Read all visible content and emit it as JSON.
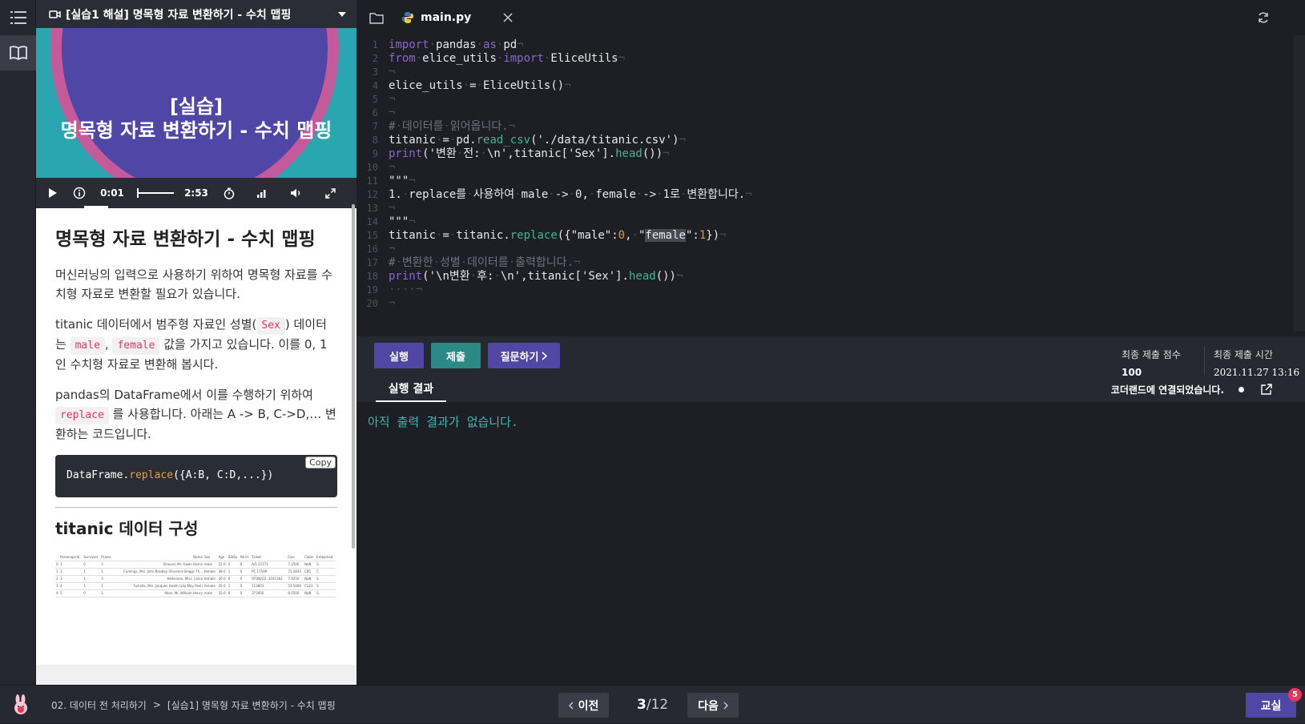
{
  "lesson": {
    "header_title": "[실습1 해설] 명목형 자료 변환하기 - 수치 맵핑",
    "video": {
      "title_line1": "[실습]",
      "title_line2": "명목형 자료 변환하기 - 수치 맵핑",
      "current_time": "0:01",
      "duration": "2:53",
      "progress_fraction": 0.006
    },
    "heading": "명목형 자료 변환하기 - 수치 맵핑",
    "p1": "머신러닝의 입력으로 사용하기 위하여 명목형 자료를 수치형 자료로 변환할 필요가 있습니다.",
    "p2_a": "titanic 데이터에서 범주형 자료인 성별(",
    "p2_sex": "Sex",
    "p2_b": ") 데이터는",
    "p2_male": "male",
    "p2_comma": ",",
    "p2_female": "female",
    "p2_c": "값을 가지고 있습니다. 이를 0, 1 인 수치형 자료로 변환해 봅시다.",
    "p3_a": "pandas의 DataFrame에서 이를 수행하기 위하여",
    "p3_replace": "replace",
    "p3_b": "를 사용합니다. 아래는 A -> B, C->D,… 변환하는 코드입니다.",
    "code_obj": "DataFrame.",
    "code_fn": "replace",
    "code_args": "({A:B, C:D,...})",
    "copy_label": "Copy",
    "subheading": "titanic 데이터 구성",
    "table": {
      "headers": [
        "",
        "PassengerId",
        "Survived",
        "Pclass",
        "Name",
        "Sex",
        "Age",
        "SibSp",
        "Parch",
        "Ticket",
        "Fare",
        "Cabin",
        "Embarked"
      ],
      "rows": [
        [
          "0",
          "1",
          "0",
          "3",
          "Braund, Mr. Owen Harris",
          "male",
          "22.0",
          "1",
          "0",
          "A/5 21171",
          "7.2500",
          "NaN",
          "S"
        ],
        [
          "1",
          "2",
          "1",
          "1",
          "Cumings, Mrs. John Bradley (Florence Briggs Th...",
          "female",
          "38.0",
          "1",
          "0",
          "PC 17599",
          "71.2833",
          "C85",
          "C"
        ],
        [
          "2",
          "3",
          "1",
          "3",
          "Heikkinen, Miss. Laina",
          "female",
          "26.0",
          "0",
          "0",
          "STON/O2. 3101282",
          "7.9250",
          "NaN",
          "S"
        ],
        [
          "3",
          "4",
          "1",
          "1",
          "Futrelle, Mrs. Jacques Heath (Lily May Peel)",
          "female",
          "35.0",
          "1",
          "0",
          "113803",
          "53.1000",
          "C123",
          "S"
        ],
        [
          "4",
          "5",
          "0",
          "3",
          "Allen, Mr. William Henry",
          "male",
          "35.0",
          "0",
          "0",
          "373450",
          "8.0500",
          "NaN",
          "S"
        ]
      ]
    }
  },
  "editor": {
    "tab_name": "main.py"
  },
  "actions": {
    "run": "실행",
    "submit": "제출",
    "ask": "질문하기",
    "final_score_label": "최종 제출 점수",
    "final_score": "100",
    "final_time_label": "최종 제출 시간",
    "final_time": "2021.11.27 13:16"
  },
  "output": {
    "tab": "실행 결과",
    "connection": "코더랜드에 연결되었습니다.",
    "empty": "아직 출력 결과가 없습니다."
  },
  "bottom": {
    "crumb_section": "02. 데이터 전 처리하기",
    "crumb_sep": ">",
    "crumb_page": "[실습1] 명목형 자료 변환하기 - 수치 맵핑",
    "prev": "이전",
    "page_current": "3",
    "page_total": "/12",
    "next": "다음",
    "classroom": "교실",
    "badge": "5"
  },
  "colors": {
    "accent": "#5046a5",
    "submit": "#2b8a84",
    "output_text": "#3db7b2"
  }
}
